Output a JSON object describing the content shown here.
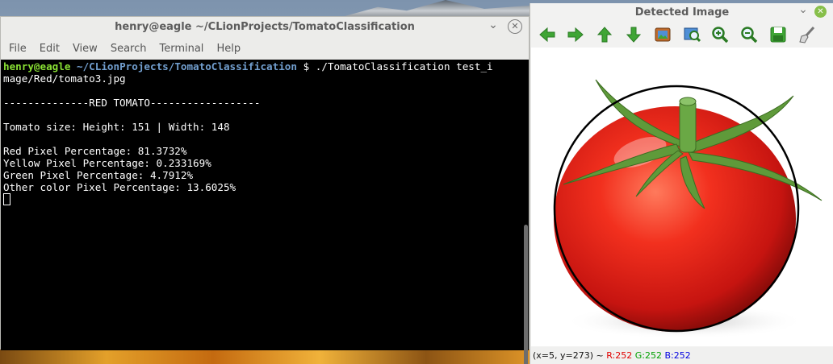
{
  "terminal": {
    "title": "henry@eagle ~/CLionProjects/TomatoClassification",
    "minimize_glyph": "⌄",
    "close_glyph": "✕",
    "menu": [
      "File",
      "Edit",
      "View",
      "Search",
      "Terminal",
      "Help"
    ],
    "prompt_user": "henry@eagle",
    "prompt_path": "~/CLionProjects/TomatoClassification",
    "prompt_symbol": "$",
    "command_line1": " ./TomatoClassification test_i",
    "command_line2": "mage/Red/tomato3.jpg",
    "output": {
      "header": "--------------RED TOMATO------------------",
      "size": "Tomato size: Height: 151 | Width: 148",
      "red": "Red Pixel Percentage: 81.3732%",
      "yellow": "Yellow Pixel Percentage: 0.233169%",
      "green": "Green Pixel Percentage: 4.7912%",
      "other": "Other color Pixel Percentage: 13.6025%"
    },
    "colors": {
      "background": "#000000",
      "text": "#ffffff",
      "prompt_user": "#8ae234",
      "prompt_path": "#729fcf"
    }
  },
  "viewer": {
    "title": "Detected Image",
    "minimize_glyph": "⌄",
    "close_glyph": "✕",
    "toolbar": [
      "arrow-left-icon",
      "arrow-right-icon",
      "arrow-up-icon",
      "arrow-down-icon",
      "image-icon",
      "zoom-fit-icon",
      "zoom-in-icon",
      "zoom-out-icon",
      "save-icon",
      "properties-brush-icon"
    ],
    "status": {
      "coords": "(x=5, y=273) ~",
      "r": "R:252",
      "g": "G:252",
      "b": "B:252"
    },
    "colors": {
      "toolbar_green": "#3fa535",
      "close_button": "#87bf4a",
      "r_text": "#e00000",
      "g_text": "#00a000",
      "b_text": "#0000e0"
    }
  }
}
